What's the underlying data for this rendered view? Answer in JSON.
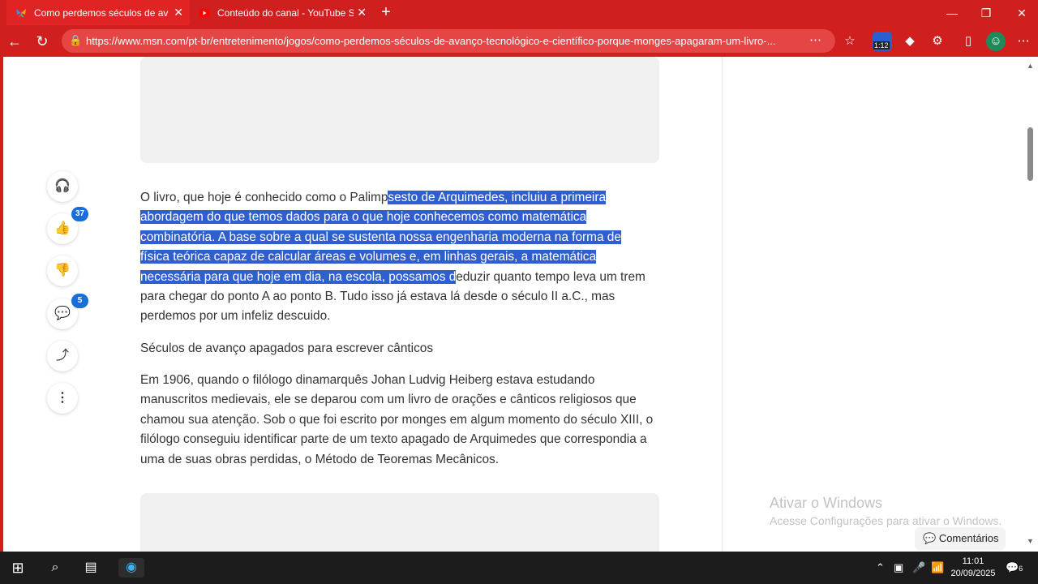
{
  "browser": {
    "tabs": [
      {
        "label": "Como perdemos séculos de avanç",
        "active": true
      },
      {
        "label": "Conteúdo do canal - YouTube Stu",
        "active": false
      }
    ],
    "new_tab": "+",
    "url": "https://www.msn.com/pt-br/entretenimento/jogos/como-perdemos-séculos-de-avanço-tecnológico-e-científico-porque-monges-apagaram-um-livro-...",
    "extension_badge": "1:12",
    "accent_color": "#cf1f1f"
  },
  "rail": {
    "like_count": "37",
    "comment_count": "5"
  },
  "article": {
    "p1_plain": "O livro, que hoje é conhecido como o Palimp",
    "p1_selected_line1": "sesto de Arquimedes, incluiu a primeira",
    "p1_selected_line2": "abordagem do que temos dados para o que hoje conhecemos como matemática",
    "p1_selected_line3": "combinatória. A base sobre a qual se sustenta nossa engenharia moderna na forma de",
    "p1_selected_line4": "física teórica capaz de calcular áreas e volumes e, em linhas gerais, a matemática",
    "p1_selected_line5": "necessária para que hoje em dia, na escola, possamos d",
    "p1_rest": "eduzir quanto tempo leva um trem para chegar do ponto A ao ponto B. Tudo isso já estava lá desde o século II a.C., mas perdemos por um infeliz descuido.",
    "heading": "Séculos de avanço apagados para escrever cânticos",
    "p2": "Em 1906, quando o filólogo dinamarquês Johan Ludvig Heiberg estava estudando manuscritos medievais, ele se deparou com um livro de orações e cânticos religiosos que chamou sua atenção. Sob o que foi escrito por monges em algum momento do século XIII, o filólogo conseguiu identificar parte de um texto apagado de Arquimedes que correspondia a uma de suas obras perdidas, o Método de Teoremas Mecânicos."
  },
  "watermark": {
    "title": "Ativar o Windows",
    "subtitle": "Acesse Configurações para ativar o Windows."
  },
  "comments_button": "Comentários",
  "taskbar": {
    "time": "11:01",
    "date": "20/09/2025",
    "notification_count": "6"
  }
}
